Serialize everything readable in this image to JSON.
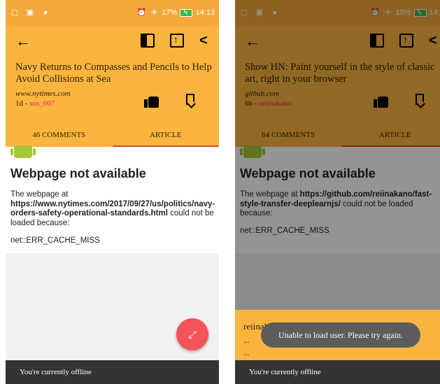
{
  "left": {
    "statusbar": {
      "battery_pct": "17%",
      "time": "14:13"
    },
    "story": {
      "title": "Navy Returns to Compasses and Pencils to Help Avoid Collisions at Sea",
      "domain": "www.nytimes.com",
      "age": "1d - ",
      "author": "sus_007"
    },
    "tabs": {
      "comments": "46 COMMENTS",
      "article": "ARTICLE"
    },
    "error": {
      "title": "Webpage not available",
      "prefix": "The webpage at ",
      "url": "https://www.nytimes.com/2017/09/27/us/politics/navy-orders-safety-operational-standards.html",
      "suffix": " could not be loaded because:",
      "code": "net::ERR_CACHE_MISS"
    },
    "fab_icon": "expand-icon",
    "offline_text": "You're currently offline"
  },
  "right": {
    "statusbar": {
      "battery_pct": "18%",
      "time": "14:1"
    },
    "story": {
      "title": "Show HN: Paint yourself in the style of classic art, right in your browser",
      "domain": "github.com",
      "age": "6h - ",
      "author": "reiinakano"
    },
    "tabs": {
      "comments": "64 COMMENTS",
      "article": "ARTICLE"
    },
    "error": {
      "title": "Webpage not available",
      "prefix": "The webpage at ",
      "url": "https://github.com/reiinakano/fast-style-transfer-deeplearnjs/",
      "suffix": " could not be loaded because:",
      "code": "net::ERR_CACHE_MISS"
    },
    "user_sheet": {
      "name": "reiinakano",
      "line1": "...",
      "line2": "..."
    },
    "toast": "Unable to load user. Please try again.",
    "offline_text": "You're currently offline"
  },
  "colors": {
    "accent": "#fbb53f",
    "statusbar": "#f5a83a",
    "author": "#e0245e",
    "fab": "#f2545b",
    "tab_indicator": "#e04040"
  }
}
